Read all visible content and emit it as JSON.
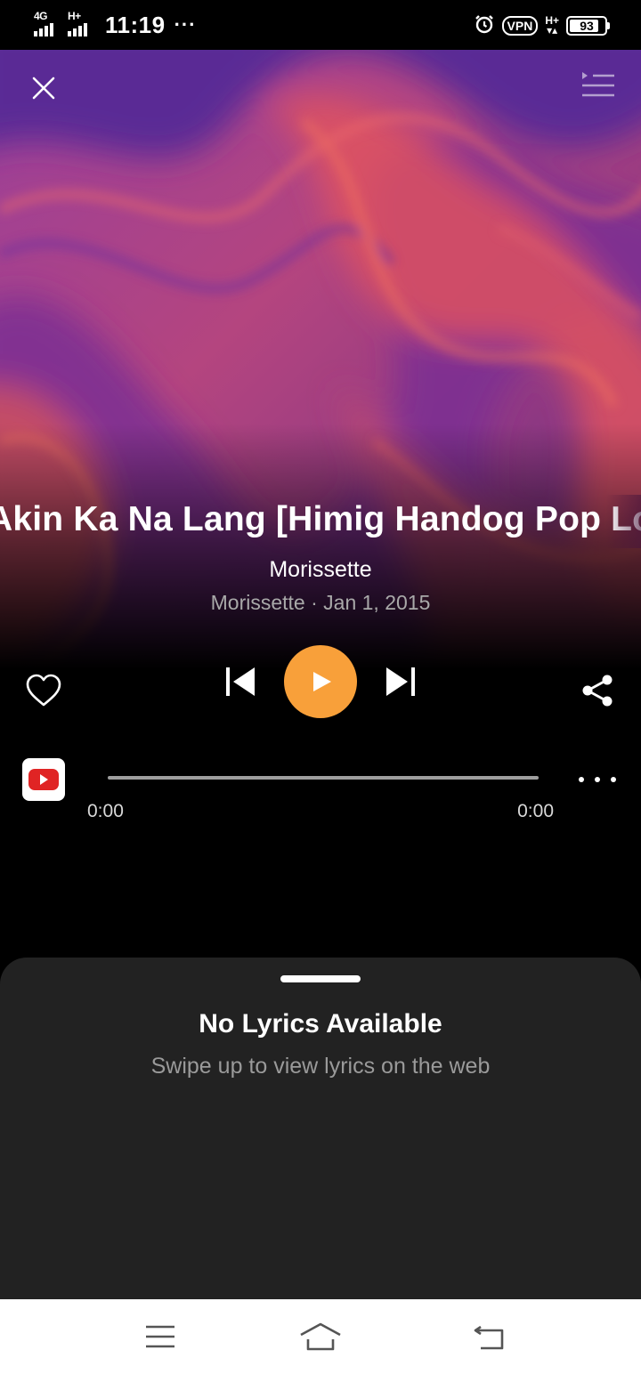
{
  "status_bar": {
    "network_1": "4G",
    "network_2": "H+",
    "time": "11:19",
    "overflow": "···",
    "vpn": "VPN",
    "network_3": "H+",
    "battery": "93",
    "battery_level": 0.93
  },
  "player": {
    "song_title": "Akin Ka Na Lang [Himig Handog Pop Love Songs]",
    "artist": "Morissette",
    "meta": "Morissette · Jan 1, 2015",
    "time_elapsed": "0:00",
    "time_total": "0:00",
    "progress": 0,
    "accent_color": "#f8a03a"
  },
  "lyrics": {
    "title": "No Lyrics Available",
    "subtitle": "Swipe up to view lyrics on the web"
  },
  "icons": {
    "close": "close-icon",
    "queue": "queue-icon",
    "like": "heart-icon",
    "previous": "skip-previous-icon",
    "play": "play-icon",
    "next": "skip-next-icon",
    "share": "share-icon",
    "source": "youtube-icon",
    "more": "more-options-icon",
    "nav_menu": "menu-icon",
    "nav_home": "home-icon",
    "nav_back": "back-icon"
  }
}
